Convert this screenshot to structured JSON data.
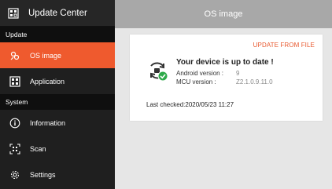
{
  "app": {
    "title": "Update Center",
    "icon": "app-grid-icon"
  },
  "sidebar": {
    "sections": [
      {
        "label": "Update",
        "items": [
          {
            "label": "OS image",
            "icon": "layers-icon",
            "active": true
          },
          {
            "label": "Application",
            "icon": "grid-icon",
            "active": false
          }
        ]
      },
      {
        "label": "System",
        "items": [
          {
            "label": "Information",
            "icon": "info-icon",
            "active": false
          },
          {
            "label": "Scan",
            "icon": "scan-icon",
            "active": false
          },
          {
            "label": "Settings",
            "icon": "gear-icon",
            "active": false
          }
        ]
      }
    ]
  },
  "header": {
    "title": "OS image"
  },
  "card": {
    "update_button": "UPDATE FROM FILE",
    "status_title": "Your device is up to date !",
    "android_label": "Android version :",
    "android_value": "9",
    "mcu_label": "MCU version :",
    "mcu_value": "Z2.1.0.9.11.0",
    "last_checked": "Last checked:2020/05/23 11:27"
  },
  "colors": {
    "accent": "#ef5a2e",
    "sidebar_bg": "#1f1f1f",
    "topbar_bg": "#a8a8a8",
    "success": "#2eaa4a"
  }
}
